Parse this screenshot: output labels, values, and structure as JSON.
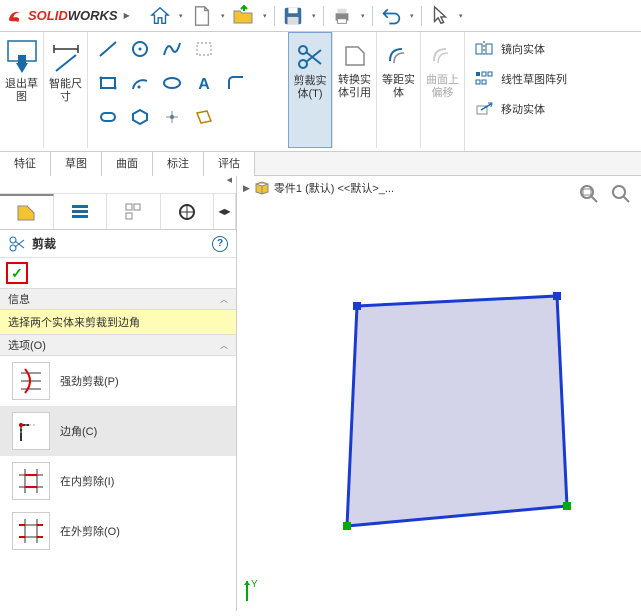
{
  "app": {
    "brand_solid": "SOLID",
    "brand_works": "WORKS"
  },
  "ribbon": {
    "exit_sketch": "退出草\n图",
    "smart_dim": "智能尺\n寸",
    "trim": "剪裁实\n体(T)",
    "convert": "转换实\n体引用",
    "offset": "等距实\n体",
    "curve_offset": "曲面上\n偏移",
    "mirror": "镜向实体",
    "linear_pattern": "线性草图阵列",
    "move": "移动实体"
  },
  "tabs": [
    "特征",
    "草图",
    "曲面",
    "标注",
    "评估"
  ],
  "pm": {
    "title": "剪裁",
    "info_hdr": "信息",
    "info_text": "选择两个实体来剪裁到边角",
    "options_hdr": "选项(O)",
    "options": [
      {
        "label": "强劲剪裁(P)"
      },
      {
        "label": "边角(C)"
      },
      {
        "label": "在内剪除(I)"
      },
      {
        "label": "在外剪除(O)"
      }
    ]
  },
  "breadcrumb": {
    "part": "零件1 (默认) <<默认>_..."
  }
}
